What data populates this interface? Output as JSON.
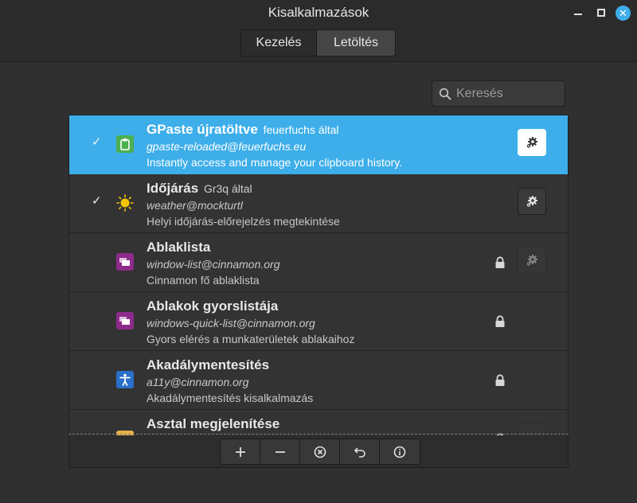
{
  "window": {
    "title": "Kisalkalmazások"
  },
  "tabs": [
    {
      "label": "Kezelés"
    },
    {
      "label": "Letöltés"
    }
  ],
  "search": {
    "placeholder": "Keresés"
  },
  "applets": [
    {
      "name": "GPaste újratöltve",
      "author": "feuerfuchs által",
      "uuid": "gpaste-reloaded@feuerfuchs.eu",
      "description": "Instantly access and manage your clipboard history.",
      "enabled": true,
      "locked": false,
      "configurable": true,
      "selected": true,
      "icon": "clipboard-icon"
    },
    {
      "name": "Időjárás",
      "author": "Gr3q által",
      "uuid": "weather@mockturtl",
      "description": "Helyi időjárás-előrejelzés megtekintése",
      "enabled": true,
      "locked": false,
      "configurable": true,
      "selected": false,
      "icon": "sun-icon"
    },
    {
      "name": "Ablaklista",
      "author": "",
      "uuid": "window-list@cinnamon.org",
      "description": "Cinnamon fő ablaklista",
      "enabled": false,
      "locked": true,
      "configurable": true,
      "selected": false,
      "icon": "window-list-icon"
    },
    {
      "name": "Ablakok gyorslistája",
      "author": "",
      "uuid": "windows-quick-list@cinnamon.org",
      "description": "Gyors elérés a munkaterületek ablakaihoz",
      "enabled": false,
      "locked": true,
      "configurable": false,
      "selected": false,
      "icon": "window-list-icon"
    },
    {
      "name": "Akadálymentesítés",
      "author": "",
      "uuid": "a11y@cinnamon.org",
      "description": "Akadálymentesítés kisalkalmazás",
      "enabled": false,
      "locked": true,
      "configurable": false,
      "selected": false,
      "icon": "accessibility-icon"
    },
    {
      "name": "Asztal megjelenítése",
      "author": "",
      "uuid": "",
      "description": "",
      "enabled": false,
      "locked": true,
      "configurable": true,
      "selected": false,
      "icon": "desktop-icon"
    }
  ],
  "toolbar": {
    "buttons": [
      {
        "icon": "plus-icon"
      },
      {
        "icon": "minus-icon"
      },
      {
        "icon": "remove-circle-icon"
      },
      {
        "icon": "undo-icon"
      },
      {
        "icon": "info-icon"
      }
    ]
  },
  "colors": {
    "accent": "#3daee9",
    "background": "#303030"
  }
}
